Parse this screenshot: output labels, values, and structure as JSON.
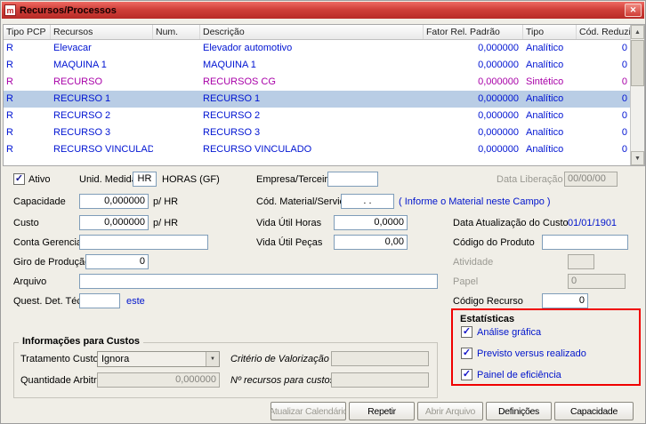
{
  "window": {
    "title": "Recursos/Processos"
  },
  "icons": {
    "close": "✕",
    "scroll_up": "▲",
    "scroll_down": "▼",
    "dropdown": "▼",
    "check": "✓",
    "app_glyph": "m"
  },
  "colors": {
    "titlebar_red": "#c9332e",
    "row_text_blue": "#0014d2",
    "row_text_purple": "#a800a8",
    "selection_bg": "#b9cde5",
    "annotation_red": "#f00000",
    "link_blue": "#0014cc"
  },
  "table": {
    "columns": [
      {
        "key": "tipo-pcp",
        "label": "Tipo PCP"
      },
      {
        "key": "recursos",
        "label": "Recursos"
      },
      {
        "key": "num",
        "label": "Num."
      },
      {
        "key": "descricao",
        "label": "Descrição"
      },
      {
        "key": "fator-rel-padrao",
        "label": "Fator Rel. Padrão"
      },
      {
        "key": "tipo",
        "label": "Tipo"
      },
      {
        "key": "cod-reduzido",
        "label": "Cód. Reduzido"
      }
    ],
    "rows": [
      {
        "cells": [
          "R",
          "Elevacar",
          "",
          "Elevador automotivo",
          "0,000000",
          "Analítico",
          "0"
        ],
        "style": "blue",
        "selected": false
      },
      {
        "cells": [
          "R",
          "MAQUINA 1",
          "",
          "MAQUINA 1",
          "0,000000",
          "Analítico",
          "0"
        ],
        "style": "blue",
        "selected": false
      },
      {
        "cells": [
          "R",
          "RECURSO",
          "",
          "RECURSOS CG",
          "0,000000",
          "Sintético",
          "0"
        ],
        "style": "purple",
        "selected": false
      },
      {
        "cells": [
          "R",
          "RECURSO 1",
          "",
          "RECURSO 1",
          "0,000000",
          "Analítico",
          "0"
        ],
        "style": "blue",
        "selected": true
      },
      {
        "cells": [
          "R",
          "RECURSO 2",
          "",
          "RECURSO 2",
          "0,000000",
          "Analítico",
          "0"
        ],
        "style": "blue",
        "selected": false
      },
      {
        "cells": [
          "R",
          "RECURSO 3",
          "",
          "RECURSO 3",
          "0,000000",
          "Analítico",
          "0"
        ],
        "style": "blue",
        "selected": false
      },
      {
        "cells": [
          "R",
          "RECURSO VINCULADO",
          "",
          "RECURSO VINCULADO",
          "0,000000",
          "Analítico",
          "0"
        ],
        "style": "blue",
        "selected": false
      }
    ]
  },
  "form": {
    "ativo_label": "Ativo",
    "unid_medida_label": "Unid. Medida",
    "unid_medida_value": "HR",
    "unid_medida_desc": "HORAS (GF)",
    "empresa_label": "Empresa/Terceiro",
    "empresa_value": "",
    "data_liberacao_label": "Data Liberação",
    "data_liberacao_value": "00/00/00",
    "capacidade_label": "Capacidade",
    "capacidade_value": "0,000000",
    "capacidade_unit": "p/ HR",
    "cod_material_label": "Cód. Material/Serviço",
    "cod_material_value": ".  .",
    "cod_material_hint": "( Informe o Material neste Campo )",
    "custo_label": "Custo",
    "custo_value": "0,000000",
    "custo_unit": "p/ HR",
    "vida_util_horas_label": "Vida Útil Horas",
    "vida_util_horas_value": "0,0000",
    "data_atualizacao_label": "Data Atualização do Custo",
    "data_atualizacao_value": "01/01/1901",
    "conta_gerencial_label": "Conta Gerencial",
    "conta_gerencial_value": "",
    "vida_util_pecas_label": "Vida Útil Peças",
    "vida_util_pecas_value": "0,00",
    "codigo_produto_label": "Código do Produto",
    "codigo_produto_value": "",
    "giro_producao_label": "Giro de Produção",
    "giro_producao_value": "0",
    "atividade_label": "Atividade",
    "atividade_value": "",
    "arquivo_label": "Arquivo",
    "arquivo_value": "",
    "papel_label": "Papel",
    "papel_value": "0",
    "quest_det_tec_label": "Quest. Det. Téc.",
    "quest_det_tec_value": "",
    "quest_det_tec_link": "este",
    "codigo_recurso_label": "Código Recurso",
    "codigo_recurso_value": "0"
  },
  "estatisticas": {
    "title": "Estatísticas",
    "options": [
      {
        "key": "analise-grafica",
        "label": "Análise gráfica",
        "checked": true
      },
      {
        "key": "previsto-versus-realizado",
        "label": "Previsto versus realizado",
        "checked": true
      },
      {
        "key": "painel-de-eficiencia",
        "label": "Painel de eficiência",
        "checked": true
      }
    ]
  },
  "custos": {
    "title": "Informações para Custos",
    "tratamento_label": "Tratamento Custos",
    "tratamento_value": "Ignora",
    "criterio_label": "Critério de Valorização",
    "criterio_value": "",
    "quantidade_label": "Quantidade Arbitrada",
    "quantidade_value": "0,000000",
    "n_recursos_label": "Nº recursos para custos",
    "n_recursos_value": ""
  },
  "buttons": [
    {
      "key": "atualizar-calendario",
      "label": "Atualizar Calendário",
      "enabled": false
    },
    {
      "key": "repetir",
      "label": "Repetir",
      "enabled": true
    },
    {
      "key": "abrir-arquivo",
      "label": "Abrir Arquivo",
      "enabled": false
    },
    {
      "key": "definicoes",
      "label": "Definições",
      "enabled": true
    },
    {
      "key": "capacidade",
      "label": "Capacidade",
      "enabled": true
    }
  ]
}
